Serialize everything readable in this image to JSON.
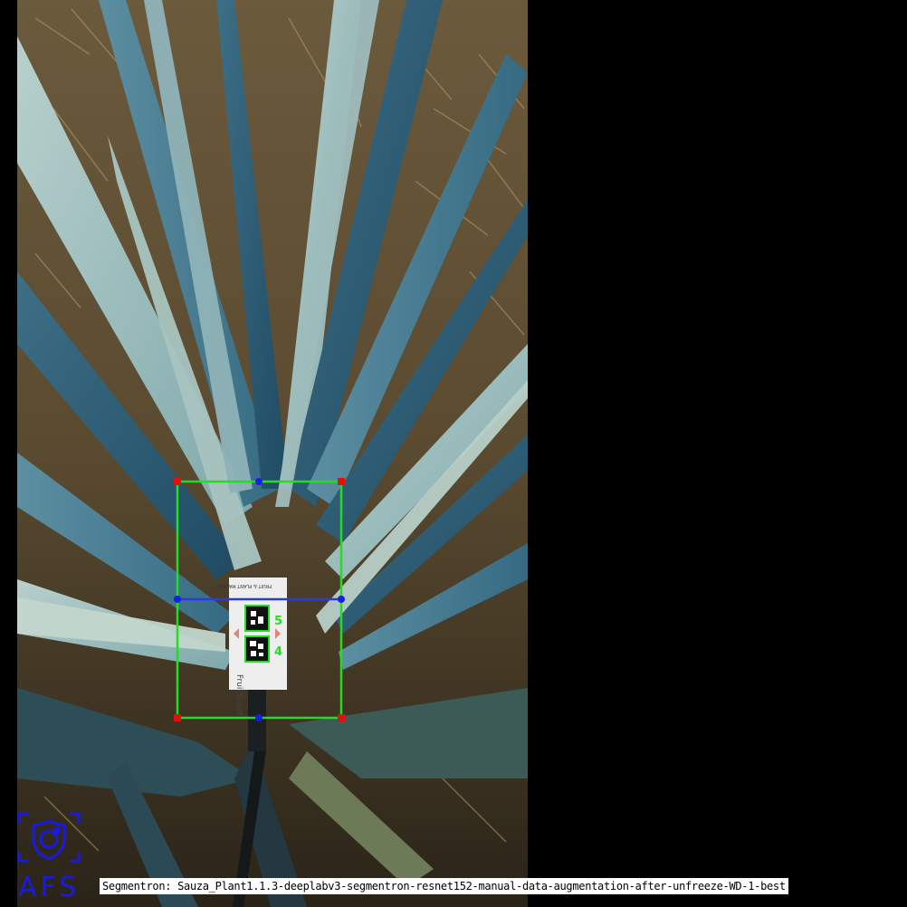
{
  "caption": {
    "text": "Segmentron: Sauza_Plant1.1.3-deeplabv3-segmentron-resnet152-manual-data-augmentation-after-unfreeze-WD-1-best"
  },
  "logo": {
    "text": "AFS",
    "icon": "shield-logo-icon",
    "color": "#1a1adf"
  },
  "marker_card": {
    "top_text": "FRUIT & PLANT MARKER",
    "bottom_text": "FruitScout",
    "marker_numbers": [
      "5",
      "4"
    ]
  },
  "overlay_colors": {
    "bbox": "#22dd22",
    "midline": "#2a3adf",
    "corner": "#e01010",
    "edge_point": "#1520e0"
  }
}
